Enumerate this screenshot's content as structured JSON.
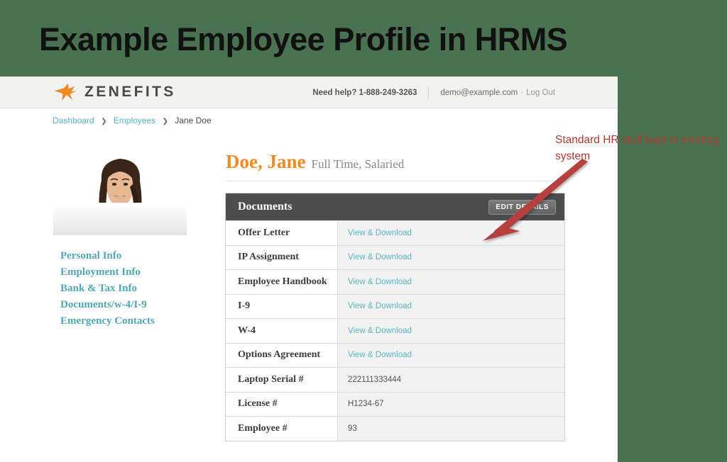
{
  "slide": {
    "title": "Example Employee Profile in HRMS",
    "background_color": "#4a7150"
  },
  "annotation": {
    "text": "Standard HR stuff kept in existing system",
    "color": "#b03a35",
    "arrow": "red-arrow-pointing-down-left"
  },
  "app": {
    "topbar": {
      "logo_text": "ZENEFITS",
      "logo_icon": "hummingbird-logo-icon",
      "logo_color": "#f08a24",
      "need_help_label": "Need help?",
      "need_help_phone": "1-888-249-3263",
      "account_email": "demo@example.com",
      "account_separator": "·",
      "logout_label": "Log Out"
    },
    "breadcrumb": {
      "items": [
        {
          "label": "Dashboard",
          "link": true
        },
        {
          "label": "Employees",
          "link": true
        },
        {
          "label": "Jane Doe",
          "link": false
        }
      ],
      "separator": "❯"
    },
    "sidebar": {
      "photo_alt": "employee-profile-photo",
      "items": [
        {
          "label": "Personal Info"
        },
        {
          "label": "Employment Info"
        },
        {
          "label": "Bank & Tax Info"
        },
        {
          "label": "Documents/w-4/I-9"
        },
        {
          "label": "Emergency Contacts"
        }
      ],
      "link_color": "#51a7b5"
    },
    "employee": {
      "name": "Doe, Jane",
      "name_color": "#f28b26",
      "status": "Full Time, Salaried"
    },
    "documents_card": {
      "title": "Documents",
      "edit_button_label": "EDIT DETAILS",
      "header_background": "#4d4d4d",
      "link_label": "View & Download",
      "rows": [
        {
          "label": "Offer Letter",
          "value": "View & Download",
          "is_link": true
        },
        {
          "label": "IP Assignment",
          "value": "View & Download",
          "is_link": true
        },
        {
          "label": "Employee Handbook",
          "value": "View & Download",
          "is_link": true
        },
        {
          "label": "I-9",
          "value": "View & Download",
          "is_link": true
        },
        {
          "label": "W-4",
          "value": "View & Download",
          "is_link": true
        },
        {
          "label": "Options Agreement",
          "value": "View & Download",
          "is_link": true
        },
        {
          "label": "Laptop Serial #",
          "value": "222111333444",
          "is_link": false
        },
        {
          "label": "License #",
          "value": "H1234-67",
          "is_link": false
        },
        {
          "label": "Employee #",
          "value": "93",
          "is_link": false
        }
      ]
    }
  }
}
